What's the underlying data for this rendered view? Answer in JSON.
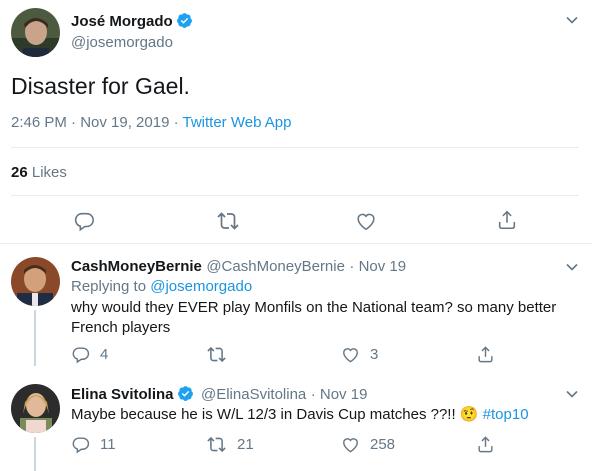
{
  "main_tweet": {
    "author_name": "José Morgado",
    "author_handle": "@josemorgado",
    "text": "Disaster for Gael.",
    "timestamp": "2:46 PM · Nov 19, 2019",
    "separator": " · ",
    "source": "Twitter Web App",
    "likes_count": "26",
    "likes_label": "Likes"
  },
  "replies": [
    {
      "author_name": "CashMoneyBernie",
      "author_handle": "@CashMoneyBernie",
      "date": "· Nov 19",
      "replying_prefix": "Replying to",
      "replying_handle": "@josemorgado",
      "text": "why would they EVER play Monfils on the National team? so many better French players",
      "reply_count": "4",
      "retweet_count": "",
      "like_count": "3"
    },
    {
      "author_name": "Elina Svitolina",
      "author_handle": "@ElinaSvitolina",
      "date": "· Nov 19",
      "text": "Maybe because he is W/L 12/3 in Davis Cup matches ??!! ",
      "emoji": "🤨",
      "hashtag": "#top10",
      "reply_count": "11",
      "retweet_count": "21",
      "like_count": "258"
    }
  ],
  "colors": {
    "accent": "#1b95e0",
    "muted": "#657786",
    "divider": "#e6ecf0",
    "verified": "#1da1f2"
  }
}
